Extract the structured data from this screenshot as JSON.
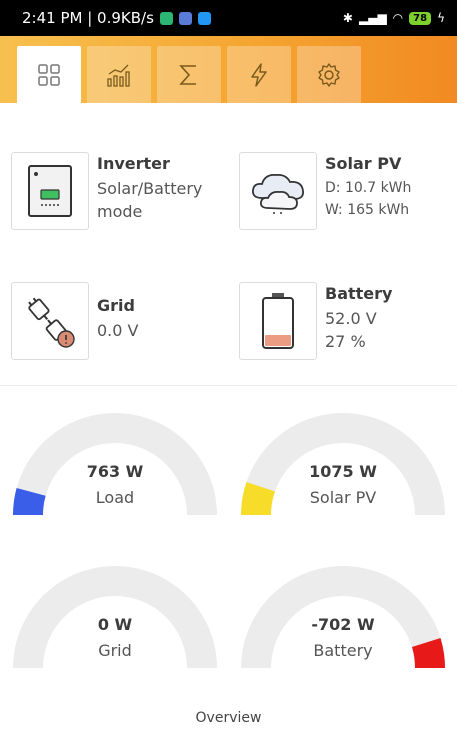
{
  "status_bar": {
    "time_speed": "2:41 PM | 0.9KB/s",
    "battery_level": "78",
    "app_icon_colors": [
      "#2bb673",
      "#5a7bd8",
      "#2196f3"
    ]
  },
  "tabs": [
    {
      "name": "grid-icon",
      "active": true
    },
    {
      "name": "chart-icon",
      "active": false
    },
    {
      "name": "sum-icon",
      "active": false
    },
    {
      "name": "lightning-icon",
      "active": false
    },
    {
      "name": "gear-icon",
      "active": false
    }
  ],
  "inverter": {
    "title": "Inverter",
    "line1": "Solar/Battery",
    "line2": "mode"
  },
  "solar": {
    "title": "Solar PV",
    "line1": "D: 10.7 kWh",
    "line2": "W: 165 kWh"
  },
  "grid": {
    "title": "Grid",
    "line1": "0.0 V"
  },
  "battery": {
    "title": "Battery",
    "line1": "52.0 V",
    "line2": "27 %"
  },
  "gauges": [
    {
      "value": "763 W",
      "label": "Load",
      "color": "#3a5ee8",
      "side": "left"
    },
    {
      "value": "1075 W",
      "label": "Solar PV",
      "color": "#f7dc2a",
      "side": "left"
    },
    {
      "value": "0 W",
      "label": "Grid",
      "color": "#e6e6e6",
      "side": "none"
    },
    {
      "value": "-702 W",
      "label": "Battery",
      "color": "#e81919",
      "side": "right"
    }
  ],
  "footer": {
    "label": "Overview"
  },
  "colors": {
    "accent_start": "#f7c04e",
    "accent_end": "#f18a22",
    "gauge_track": "#ececec"
  }
}
